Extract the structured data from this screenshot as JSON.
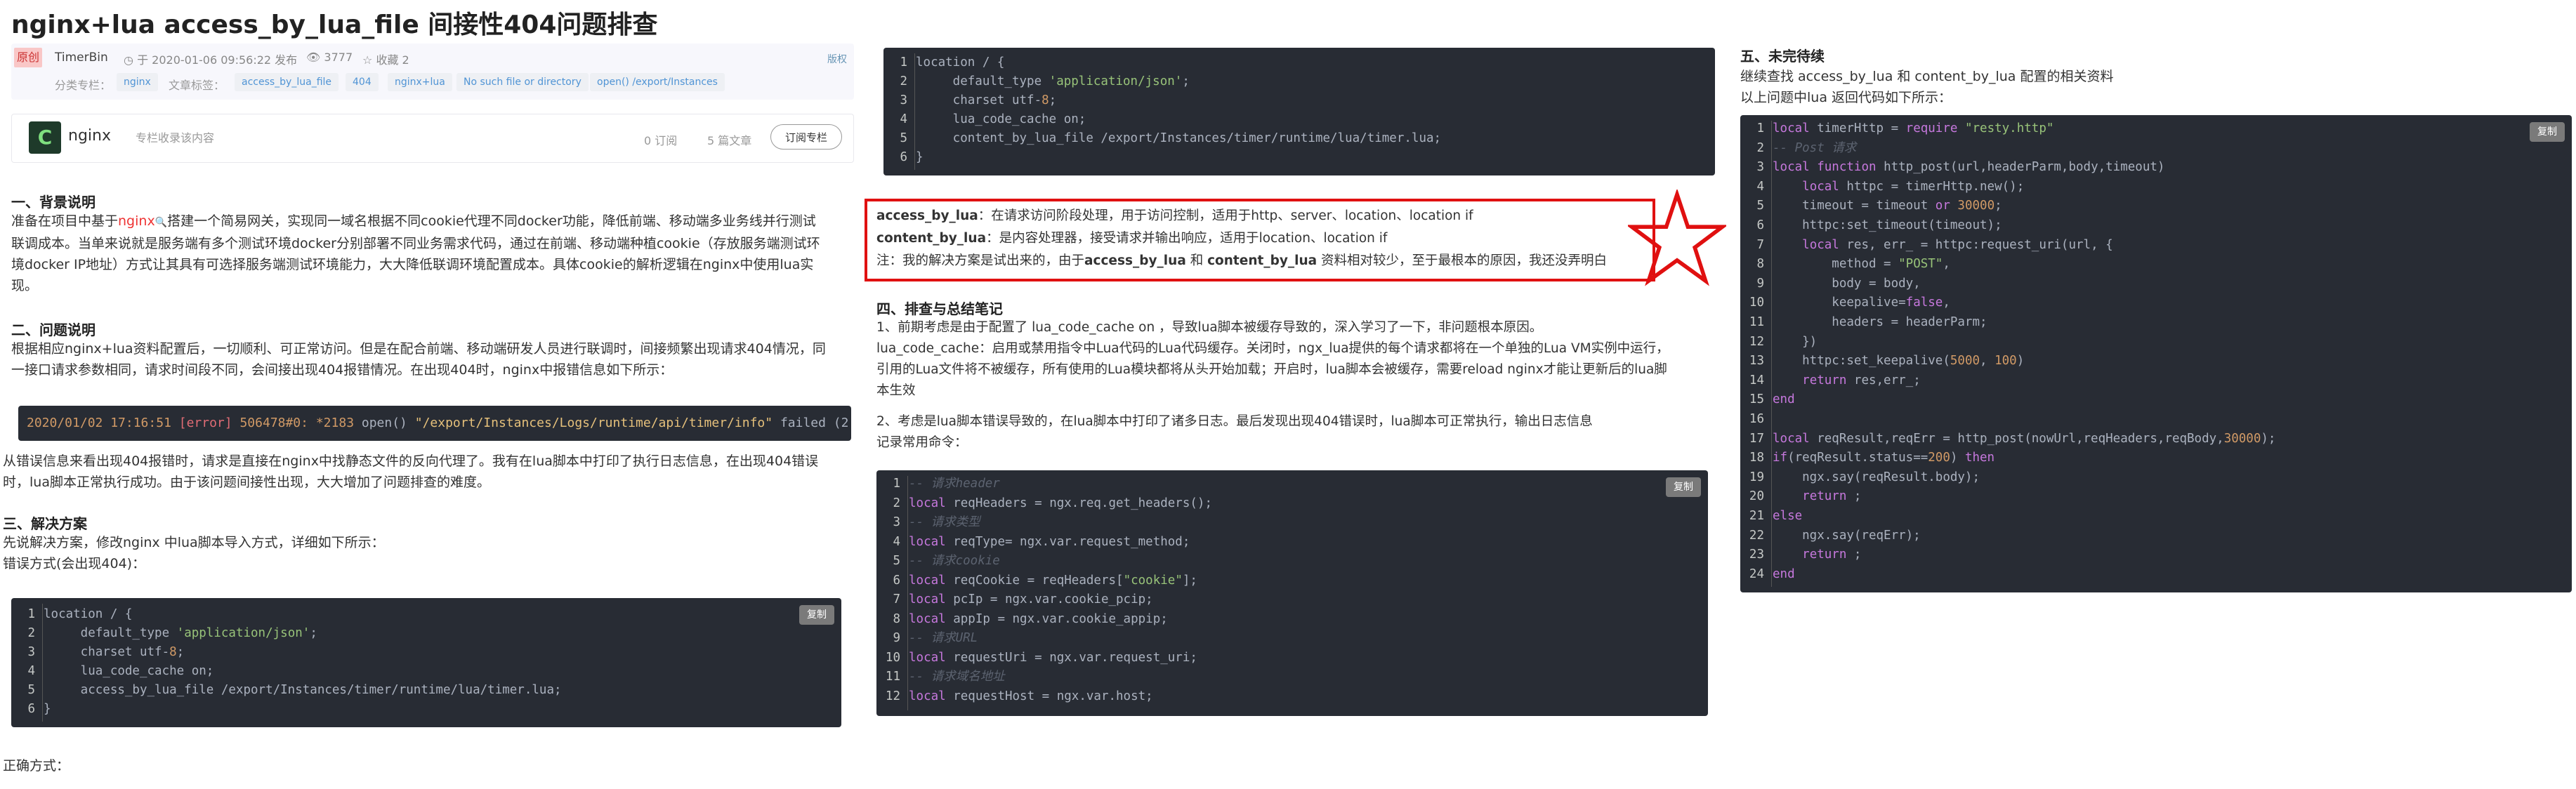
{
  "title": "nginx+lua access_by_lua_file 间接性404问题排查",
  "meta": {
    "original_badge": "原创",
    "author": "TimerBin",
    "published": "于 2020-01-06 09:56:22 发布",
    "views": "3777",
    "collect": "收藏 2",
    "copyright": "版权",
    "category_label": "分类专栏：",
    "category": "nginx",
    "tags_label": "文章标签：",
    "tags": [
      "access_by_lua_file",
      "404",
      "nginx+lua",
      "No such file or directory",
      "open() /export/Instances"
    ]
  },
  "column": {
    "icon_letter": "C",
    "name": "nginx",
    "subtitle": "专栏收录该内容",
    "subscriptions": "0 订阅",
    "articles": "5 篇文章",
    "subscribe_btn": "订阅专栏"
  },
  "sections": {
    "s1_title": "一、背景说明",
    "s1_l1a": "准备在项目中基于",
    "s1_l1link": "nginx",
    "s1_l1b": "搭建一个简易网关，实现同一域名根据不同cookie代理不同docker功能，降低前端、移动端多业务线并行测试",
    "s1_l2": "联调成本。当单来说就是服务端有多个测试环境docker分别部署不同业务需求代码，通过在前端、移动端种植cookie（存放服务端测试环",
    "s1_l3": "境docker IP地址）方式让其具有可选择服务端测试环境能力，大大降低联调环境配置成本。具体cookie的解析逻辑在nginx中使用lua实",
    "s1_l4": "现。",
    "s2_title": "二、问题说明",
    "s2_l1": "根据相应nginx+lua资料配置后，一切顺利、可正常访问。但是在配合前端、移动端研发人员进行联调时，间接频繁出现请求404情况，同",
    "s2_l2": "一接口请求参数相同，请求时间段不同，会间接出现404报错情况。在出现404时，nginx中报错信息如下所示：",
    "log_time": "2020/01/02 17:16:51",
    "log_level": "[error]",
    "log_pid": "506478#0:",
    "log_id": "*2183",
    "log_rest": "open()",
    "log_path": "\"/export/Instances/Logs/runtime/api/timer/info\"",
    "log_tail": "failed (2: No such file or directory)",
    "s2_l3": "从错误信息来看出现404报错时，请求是直接在nginx中找静态文件的反向代理了。我有在lua脚本中打印了执行日志信息，在出现404错误",
    "s2_l4": "时，lua脚本正常执行成功。由于该问题间接性出现，大大增加了问题排查的难度。",
    "s3_title": "三、解决方案",
    "s3_l1": "先说解决方案，修改nginx 中lua脚本导入方式，详细如下所示：",
    "s3_l2": "错误方式(会出现404)：",
    "s3_correct": "正确方式：",
    "copy": "复制",
    "note_l1a": "access_by_lua",
    "note_l1b": "：在请求访问阶段处理，用于访问控制，适用于http、server、location、location if",
    "note_l2a": "content_by_lua",
    "note_l2b": "：是内容处理器，接受请求并输出响应，适用于location、location if",
    "note_l3a": "注：我的解决方案是试出来的，由于",
    "note_l3b": "access_by_lua",
    "note_l3c": " 和 ",
    "note_l3d": "content_by_lua",
    "note_l3e": " 资料相对较少，至于最根本的原因，我还没弄明白",
    "s4_title": "四、排查与总结笔记",
    "s4_l1": "1、前期考虑是由于配置了 lua_code_cache on ，导致lua脚本被缓存导致的，深入学习了一下，非问题根本原因。",
    "s4_l2": "lua_code_cache：启用或禁用指令中Lua代码的Lua代码缓存。关闭时，ngx_lua提供的每个请求都将在一个单独的Lua VM实例中运行，",
    "s4_l3": "引用的Lua文件将不被缓存，所有使用的Lua模块都将从头开始加载；开启时，lua脚本会被缓存，需要reload nginx才能让更新后的lua脚",
    "s4_l4": "本生效",
    "s4_l5": "2、考虑是lua脚本错误导致的，在lua脚本中打印了诸多日志。最后发现出现404错误时，lua脚本可正常执行，输出日志信息",
    "s4_l6": "记录常用命令：",
    "s5_title": "五、未完待续",
    "s5_l1": "继续查找 access_by_lua  和 content_by_lua 配置的相关资料",
    "s5_l2": "以上问题中lua 返回代码如下所示："
  },
  "code_nginx": [
    "location / {",
    "     default_type 'application/json';",
    "     charset utf-8;",
    "     lua_code_cache on;",
    "     access_by_lua_file /export/Instances/timer/runtime/lua/timer.lua;",
    "}"
  ],
  "code_nginx2_last": "     content_by_lua_file /export/Instances/timer/runtime/lua/timer.lua;",
  "code_vars": [
    "-- 请求header",
    "local reqHeaders = ngx.req.get_headers();",
    "-- 请求类型",
    "local reqType= ngx.var.request_method;",
    "-- 请求cookie",
    "local reqCookie = reqHeaders[\"cookie\"];",
    "local pcIp = ngx.var.cookie_pcip;",
    "local appIp = ngx.var.cookie_appip;",
    "-- 请求URL",
    "local requestUri = ngx.var.request_uri;",
    "-- 请求域名地址",
    "local requestHost = ngx.var.host;"
  ],
  "code_http": [
    "local timerHttp = require \"resty.http\"",
    "-- Post 请求",
    "local function http_post(url,headerParm,body,timeout)",
    "    local httpc = timerHttp.new();",
    "    timeout = timeout or 30000;",
    "    httpc:set_timeout(timeout);",
    "    local res, err_ = httpc:request_uri(url, {",
    "        method = \"POST\",",
    "        body = body,",
    "        keepalive=false,",
    "        headers = headerParm;",
    "    })",
    "    httpc:set_keepalive(5000, 100)",
    "    return res,err_;",
    "end",
    "",
    "local reqResult,reqErr = http_post(nowUrl,reqHeaders,reqBody,30000);",
    "if(reqResult.status==200) then",
    "    ngx.say(reqResult.body);",
    "    return ;",
    "else",
    "    ngx.say(reqErr);",
    "    return ;",
    "end"
  ]
}
